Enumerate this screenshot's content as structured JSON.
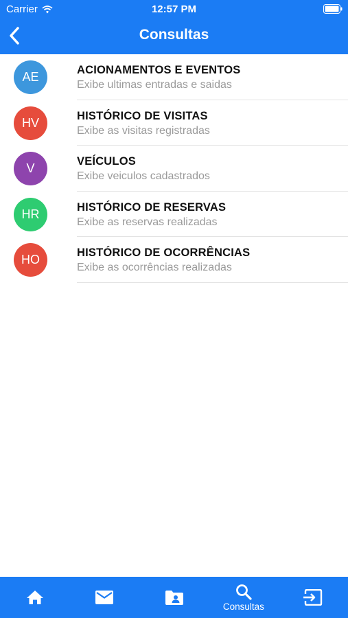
{
  "status_bar": {
    "carrier": "Carrier",
    "time": "12:57 PM"
  },
  "navbar": {
    "title": "Consultas"
  },
  "colors": {
    "primary": "#1b7cf4"
  },
  "items": [
    {
      "initials": "AE",
      "title": "ACIONAMENTOS E EVENTOS",
      "subtitle": "Exibe ultimas entradas e saidas",
      "color": "#3d97dd"
    },
    {
      "initials": "HV",
      "title": "HISTÓRICO DE VISITAS",
      "subtitle": "Exibe as visitas registradas",
      "color": "#e64c3c"
    },
    {
      "initials": "V",
      "title": "VEÍCULOS",
      "subtitle": "Exibe veiculos cadastrados",
      "color": "#8e44ad"
    },
    {
      "initials": "HR",
      "title": "HISTÓRICO DE RESERVAS",
      "subtitle": "Exibe as reservas realizadas",
      "color": "#2ecc71"
    },
    {
      "initials": "HO",
      "title": "HISTÓRICO DE OCORRÊNCIAS",
      "subtitle": "Exibe as ocorrências realizadas",
      "color": "#e64c3c"
    }
  ],
  "tabbar": {
    "tabs": [
      {
        "icon": "home-icon",
        "label": ""
      },
      {
        "icon": "mail-icon",
        "label": ""
      },
      {
        "icon": "contact-folder-icon",
        "label": ""
      },
      {
        "icon": "search-icon",
        "label": "Consultas"
      },
      {
        "icon": "exit-icon",
        "label": ""
      }
    ]
  }
}
